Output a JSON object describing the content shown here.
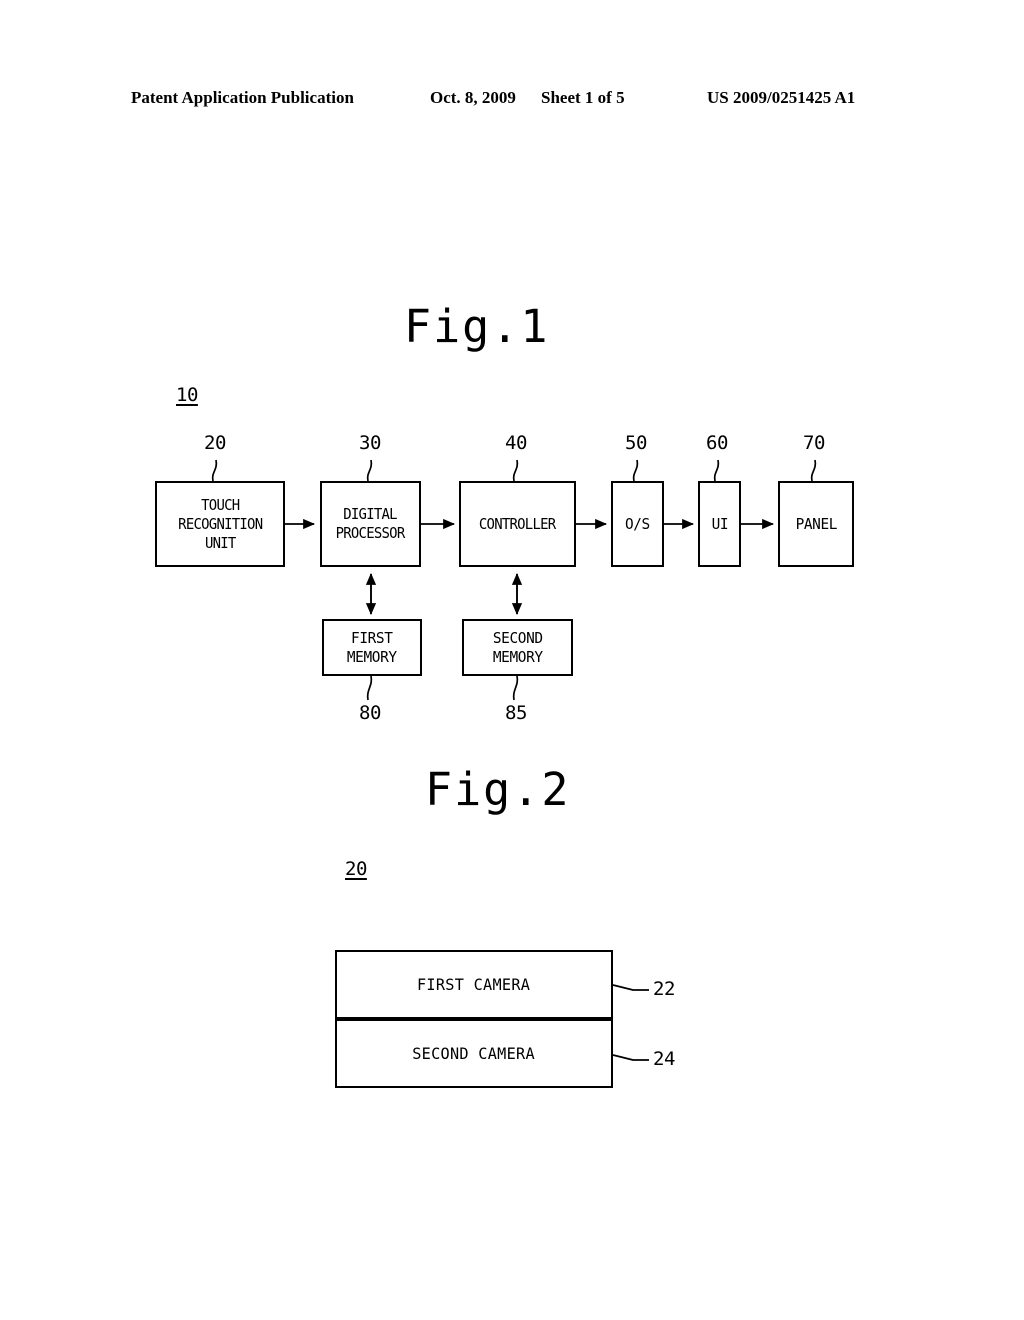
{
  "header": {
    "publication": "Patent Application Publication",
    "date": "Oct. 8, 2009",
    "sheet": "Sheet 1 of 5",
    "document_number": "US 2009/0251425 A1"
  },
  "figure1": {
    "title": "Fig.1",
    "system_ref": "10",
    "blocks": [
      {
        "ref": "20",
        "label": "TOUCH\nRECOGNITION\nUNIT"
      },
      {
        "ref": "30",
        "label": "DIGITAL\nPROCESSOR"
      },
      {
        "ref": "40",
        "label": "CONTROLLER"
      },
      {
        "ref": "50",
        "label": "O/S"
      },
      {
        "ref": "60",
        "label": "UI"
      },
      {
        "ref": "70",
        "label": "PANEL"
      },
      {
        "ref": "80",
        "label": "FIRST\nMEMORY"
      },
      {
        "ref": "85",
        "label": "SECOND\nMEMORY"
      }
    ]
  },
  "figure2": {
    "title": "Fig.2",
    "unit_ref": "20",
    "rows": [
      {
        "ref": "22",
        "label": "FIRST CAMERA"
      },
      {
        "ref": "24",
        "label": "SECOND CAMERA"
      }
    ]
  },
  "colors": {
    "ink": "#000000",
    "paper": "#ffffff"
  }
}
